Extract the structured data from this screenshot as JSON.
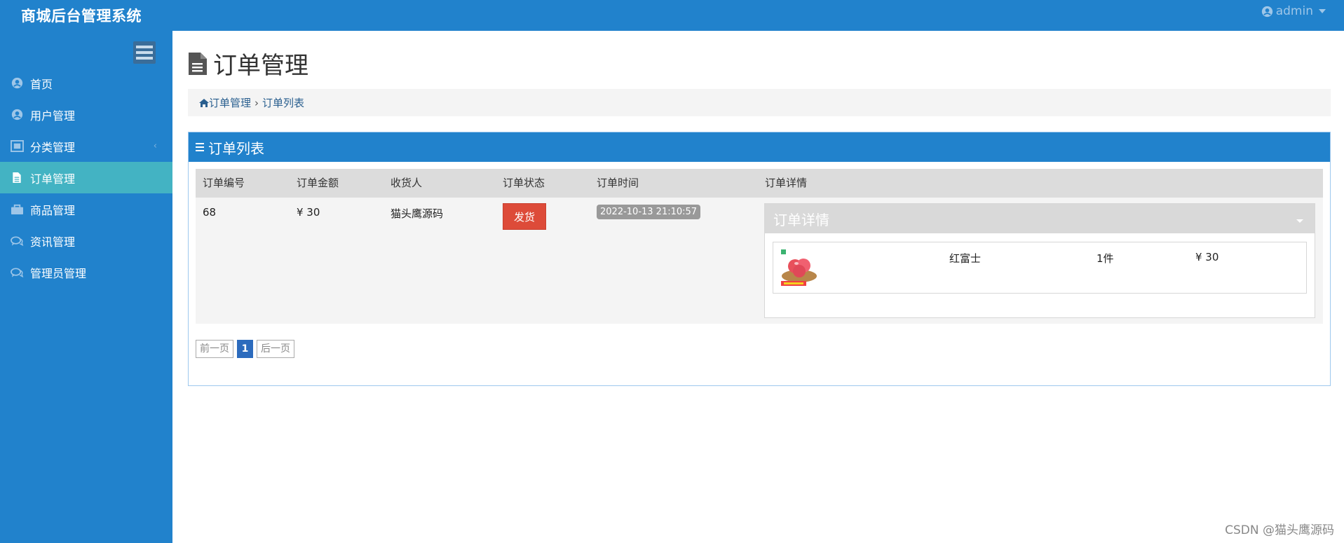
{
  "app": {
    "title": "商城后台管理系统",
    "user": "admin"
  },
  "sidebar": {
    "items": [
      {
        "label": "首页",
        "icon": "user-circle-icon"
      },
      {
        "label": "用户管理",
        "icon": "user-circle-icon"
      },
      {
        "label": "分类管理",
        "icon": "category-icon",
        "chevron": "‹"
      },
      {
        "label": "订单管理",
        "icon": "document-icon",
        "active": true
      },
      {
        "label": "商品管理",
        "icon": "bag-icon"
      },
      {
        "label": "资讯管理",
        "icon": "chat-icon"
      },
      {
        "label": "管理员管理",
        "icon": "chat-icon"
      }
    ]
  },
  "page": {
    "title": "订单管理",
    "breadcrumb": [
      "订单管理",
      "订单列表"
    ],
    "breadcrumb_sep": "›"
  },
  "panel": {
    "title": "订单列表"
  },
  "table": {
    "headers": [
      "订单编号",
      "订单金额",
      "收货人",
      "订单状态",
      "订单时间",
      "订单详情"
    ],
    "row": {
      "id": "68",
      "amount": "¥ 30",
      "receiver": "猫头鹰源码",
      "status_button": "发货",
      "time": "2022-10-13 21:10:57",
      "detail_title": "订单详情",
      "product": {
        "name": "红富士",
        "qty": "1件",
        "price": "¥ 30"
      }
    }
  },
  "pager": {
    "prev": "前一页",
    "current": "1",
    "next": "后一页"
  },
  "watermark": "CSDN @猫头鹰源码",
  "colors": {
    "primary": "#2182cc",
    "active": "#43b3c3",
    "danger": "#dd4b39"
  }
}
